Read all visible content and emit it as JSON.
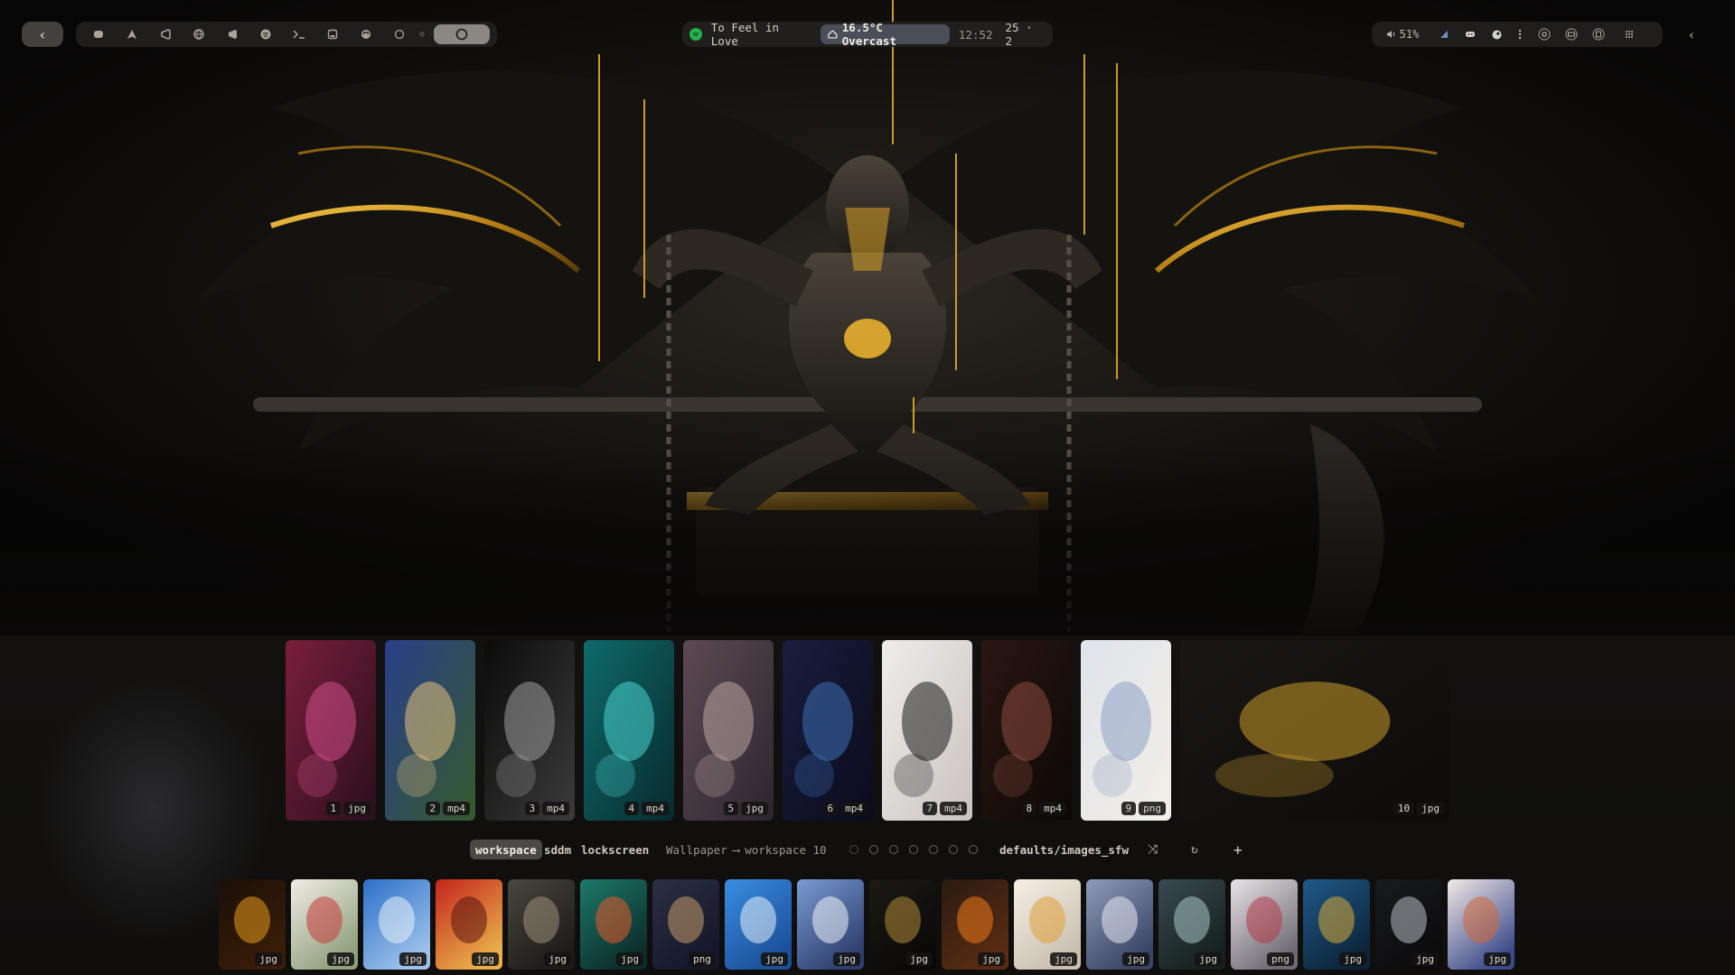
{
  "topbar": {
    "back_label": "‹",
    "launcher_icons": [
      "apps-icon",
      "arch-icon",
      "vscode-icon",
      "browser-icon",
      "vscode-alt-icon",
      "spotify-icon",
      "terminal-icon",
      "files-icon",
      "discord-icon",
      "circle-icon",
      "small-dot-icon"
    ],
    "media": {
      "track": "To Feel in Love",
      "weather": "16.5°C Overcast",
      "time": "12:52",
      "date": "25 · 2"
    },
    "status": {
      "volume": "51%"
    },
    "collapse_label": "‹"
  },
  "gallery": {
    "featured": [
      {
        "num": "1",
        "ext": "jpg",
        "palette": [
          "#7a1e3c",
          "#d24f8a",
          "#2a0f1c"
        ]
      },
      {
        "num": "2",
        "ext": "mp4",
        "palette": [
          "#2b3f8a",
          "#e4c07a",
          "#355a2c"
        ]
      },
      {
        "num": "3",
        "ext": "mp4",
        "palette": [
          "#0b0b0b",
          "#9d9d9d",
          "#3b3b3b"
        ]
      },
      {
        "num": "4",
        "ext": "mp4",
        "palette": [
          "#0f6a6a",
          "#4ad3cf",
          "#082a2e"
        ]
      },
      {
        "num": "5",
        "ext": "jpg",
        "palette": [
          "#5c4a52",
          "#b9a6a1",
          "#2e2530"
        ]
      },
      {
        "num": "6",
        "ext": "mp4",
        "palette": [
          "#1a1d3e",
          "#3d6fb5",
          "#0a0b1c"
        ]
      },
      {
        "num": "7",
        "ext": "mp4",
        "palette": [
          "#efeceb",
          "#1a1a1a",
          "#c9c3c0"
        ]
      },
      {
        "num": "8",
        "ext": "mp4",
        "palette": [
          "#2a1612",
          "#8a4b3e",
          "#0d0806"
        ]
      },
      {
        "num": "9",
        "ext": "png",
        "palette": [
          "#dfe3ec",
          "#8ea1c4",
          "#f4efe6"
        ]
      },
      {
        "num": "10",
        "ext": "jpg",
        "palette": [
          "#1a1714",
          "#c99a2a",
          "#0c0b0a"
        ]
      }
    ]
  },
  "controls": {
    "tabs": [
      "workspace",
      "sddm",
      "lockscreen"
    ],
    "target_label": "Wallpaper",
    "arrow": "⟶",
    "target_value": "workspace 10",
    "folder": "defaults/images_sfw",
    "shuffle_label": "⤨",
    "refresh_label": "↻",
    "add_label": "+"
  },
  "strip": [
    {
      "ext": "jpg",
      "palette": [
        "#1a0f08",
        "#e69a1c",
        "#3a1d08"
      ]
    },
    {
      "ext": "jpg",
      "palette": [
        "#f1ece6",
        "#c63a3a",
        "#8fa07c"
      ]
    },
    {
      "ext": "jpg",
      "palette": [
        "#2c6fc9",
        "#e9f0f8",
        "#9cc2e9"
      ]
    },
    {
      "ext": "jpg",
      "palette": [
        "#c4231c",
        "#5a1410",
        "#e9b04a"
      ]
    },
    {
      "ext": "jpg",
      "palette": [
        "#4a4640",
        "#9b8f7a",
        "#1d1b18"
      ]
    },
    {
      "ext": "jpg",
      "palette": [
        "#1c7a6a",
        "#e85a2a",
        "#0d2c2a"
      ]
    },
    {
      "ext": "png",
      "palette": [
        "#2b3042",
        "#c59a6a",
        "#15172a"
      ]
    },
    {
      "ext": "jpg",
      "palette": [
        "#3a8ee0",
        "#e8f2fb",
        "#1b4f9a"
      ]
    },
    {
      "ext": "jpg",
      "palette": [
        "#7a9bd3",
        "#f1f4fa",
        "#2e3f6e"
      ]
    },
    {
      "ext": "jpg",
      "palette": [
        "#1d1a15",
        "#b08a3a",
        "#0a0908"
      ]
    },
    {
      "ext": "jpg",
      "palette": [
        "#2a1a12",
        "#f07a1a",
        "#5a2c12"
      ]
    },
    {
      "ext": "jpg",
      "palette": [
        "#f5efe4",
        "#e0a13a",
        "#c9bfb0"
      ]
    },
    {
      "ext": "jpg",
      "palette": [
        "#8f9bb8",
        "#e6eaf3",
        "#3a4466"
      ]
    },
    {
      "ext": "jpg",
      "palette": [
        "#3a4a50",
        "#a8c4c6",
        "#16211f"
      ]
    },
    {
      "ext": "png",
      "palette": [
        "#e9e3e6",
        "#b33b48",
        "#6e6a74"
      ]
    },
    {
      "ext": "jpg",
      "palette": [
        "#1f5a8a",
        "#d9a93a",
        "#0d2438"
      ]
    },
    {
      "ext": "jpg",
      "palette": [
        "#1a1b1e",
        "#b9bcc4",
        "#0b0b0c"
      ]
    },
    {
      "ext": "jpg",
      "palette": [
        "#f2e9e6",
        "#d0683a",
        "#3b4a8a"
      ]
    }
  ]
}
